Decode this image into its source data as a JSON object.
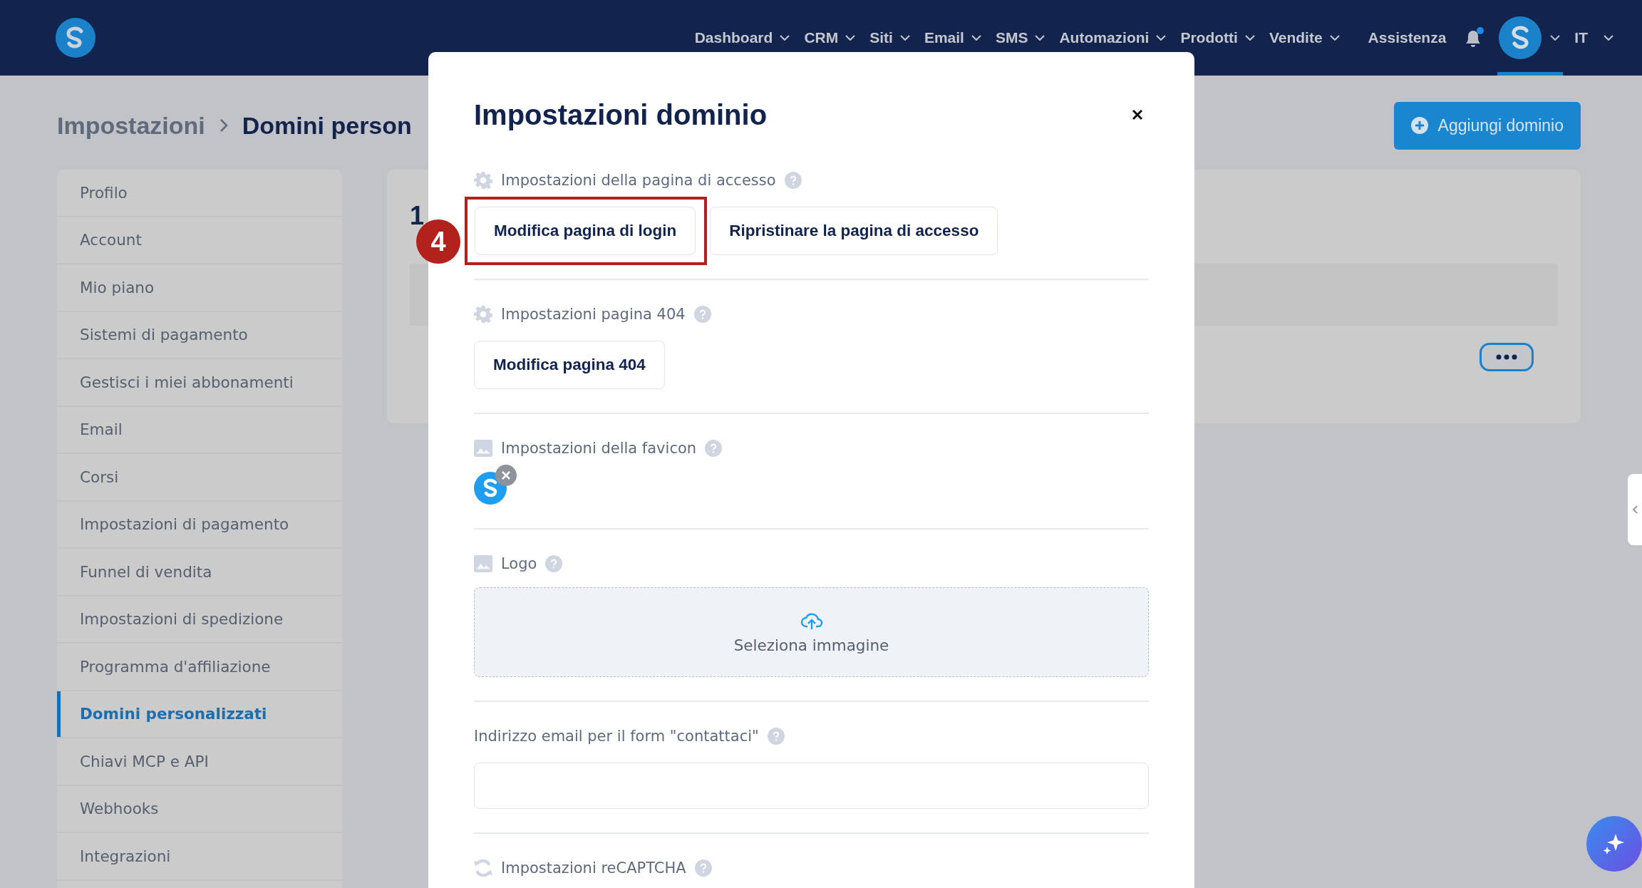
{
  "nav": {
    "items": [
      {
        "label": "Dashboard"
      },
      {
        "label": "CRM"
      },
      {
        "label": "Siti"
      },
      {
        "label": "Email"
      },
      {
        "label": "SMS"
      },
      {
        "label": "Automazioni"
      },
      {
        "label": "Prodotti"
      },
      {
        "label": "Vendite"
      }
    ],
    "help": "Assistenza",
    "notification": true,
    "language": "IT"
  },
  "breadcrumb": {
    "parent": "Impostazioni",
    "current": "Domini person"
  },
  "add_button": "Aggiungi dominio",
  "sidebar": {
    "items": [
      {
        "label": "Profilo",
        "selected": false
      },
      {
        "label": "Account",
        "selected": false
      },
      {
        "label": "Mio piano",
        "selected": false
      },
      {
        "label": "Sistemi di pagamento",
        "selected": false
      },
      {
        "label": "Gestisci i miei abbonamenti",
        "selected": false
      },
      {
        "label": "Email",
        "selected": false
      },
      {
        "label": "Corsi",
        "selected": false
      },
      {
        "label": "Impostazioni di pagamento",
        "selected": false
      },
      {
        "label": "Funnel di vendita",
        "selected": false
      },
      {
        "label": "Impostazioni di spedizione",
        "selected": false
      },
      {
        "label": "Programma d'affiliazione",
        "selected": false
      },
      {
        "label": "Domini personalizzati",
        "selected": true
      },
      {
        "label": "Chiavi MCP e API",
        "selected": false
      },
      {
        "label": "Webhooks",
        "selected": false
      },
      {
        "label": "Integrazioni",
        "selected": false
      }
    ]
  },
  "content": {
    "count": "1"
  },
  "modal": {
    "title": "Impostazioni dominio",
    "sections": [
      {
        "kind": "buttons",
        "label": "Impostazioni della pagina di accesso",
        "buttons": [
          {
            "label": "Modifica pagina di login",
            "highlighted": true
          },
          {
            "label": "Ripristinare la pagina di accesso",
            "highlighted": false
          }
        ]
      },
      {
        "kind": "buttons",
        "label": "Impostazioni pagina 404",
        "buttons": [
          {
            "label": "Modifica pagina 404",
            "highlighted": false
          }
        ]
      },
      {
        "kind": "favicon",
        "label": "Impostazioni della favicon"
      },
      {
        "kind": "dropzone",
        "label": "Logo",
        "text": "Seleziona immagine"
      },
      {
        "kind": "input",
        "label": "Indirizzo email per il form \"contattaci\""
      },
      {
        "kind": "header",
        "label": "Impostazioni reCAPTCHA"
      }
    ]
  },
  "annotation": {
    "badge": "4"
  }
}
